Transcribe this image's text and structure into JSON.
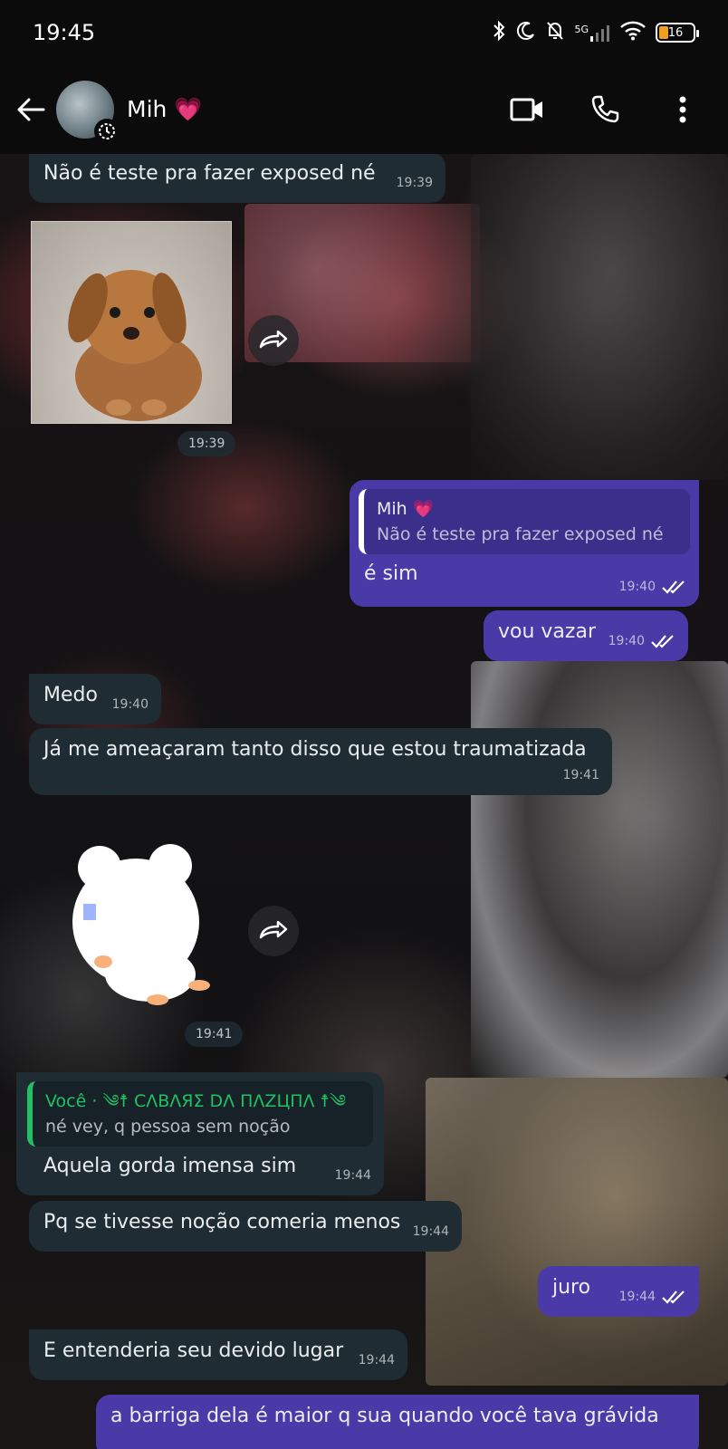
{
  "status_bar": {
    "time": "19:45",
    "network": "5G",
    "battery": "16"
  },
  "header": {
    "contact_name": "Mih 💗"
  },
  "messages": [
    {
      "text": "Não é teste pra fazer exposed né",
      "time": "19:39"
    },
    {
      "sticker": "puppy-sticker",
      "time": "19:39"
    },
    {
      "quote_author": "Mih 💗",
      "quote_text": "Não é teste pra fazer exposed né",
      "text": "é sim",
      "time": "19:40"
    },
    {
      "text": "vou vazar",
      "time": "19:40"
    },
    {
      "text": "Medo",
      "time": "19:40"
    },
    {
      "text": "Já me ameaçaram tanto disso que estou traumatizada",
      "time": "19:41"
    },
    {
      "sticker": "bear-sticker",
      "time": "19:41"
    },
    {
      "quote_author": "Você · ༄☨ CΛBΛЯΣ DΛ ПΛZЦПΛ ☨༄",
      "quote_text": "né vey, q pessoa sem noção",
      "text": "Aquela gorda imensa sim",
      "time": "19:44"
    },
    {
      "text": "Pq se tivesse noção comeria menos",
      "time": "19:44"
    },
    {
      "text": "juro",
      "time": "19:44"
    },
    {
      "text": "E entenderia seu devido lugar",
      "time": "19:44"
    },
    {
      "text": "a barriga dela é maior q sua quando você tava grávida"
    }
  ],
  "colors": {
    "incoming_bubble": "#1f2c33",
    "outgoing_bubble": "#4a3aa8",
    "quote_green": "#21c063"
  }
}
